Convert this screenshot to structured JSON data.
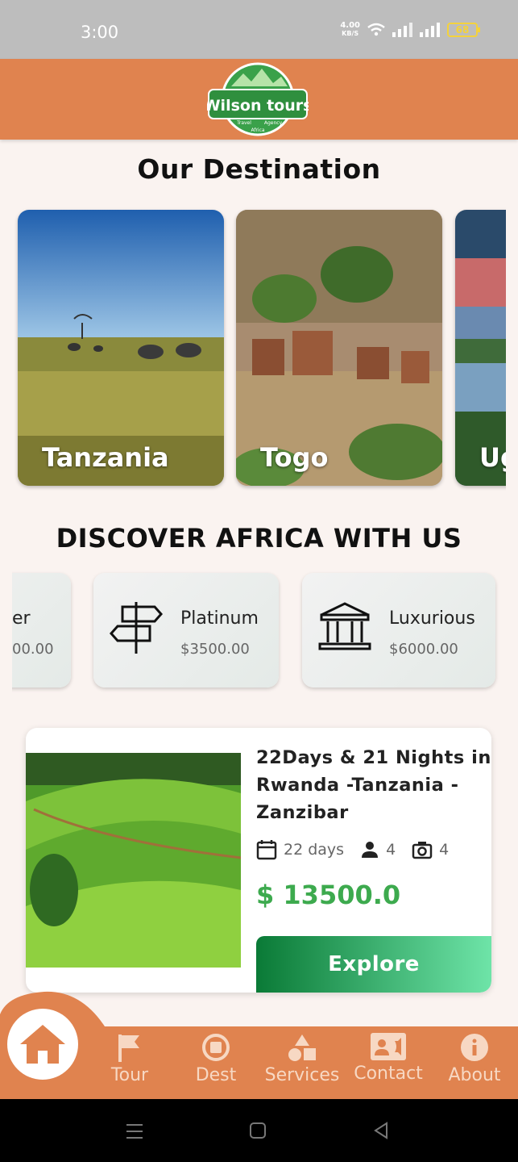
{
  "status_bar": {
    "time": "3:00",
    "net_speed_value": "4.00",
    "net_speed_unit": "KB/S",
    "battery": "68"
  },
  "header": {
    "logo_text": "Wilson tours",
    "logo_sub1": "Travel",
    "logo_sub2": "Agency",
    "logo_sub3": "Africa"
  },
  "destinations": {
    "title": "Our Destination",
    "items": [
      {
        "label": "Tanzania"
      },
      {
        "label": "Togo"
      },
      {
        "label": "Ug"
      }
    ]
  },
  "discover": {
    "title": "DISCOVER AFRICA WITH US",
    "packages": [
      {
        "name": "er",
        "price": "00.00"
      },
      {
        "name": "Platinum",
        "price": "$3500.00",
        "icon": "signpost-icon"
      },
      {
        "name": "Luxurious",
        "price": "$6000.00",
        "icon": "bank-building-icon"
      }
    ]
  },
  "tour": {
    "title": "22Days & 21 Nights in Rwanda -Tanzania -Zanzibar",
    "duration": "22 days",
    "people": "4",
    "photos": "4",
    "price": "$ 13500.0",
    "cta": "Explore"
  },
  "bottom_nav": {
    "items": [
      {
        "label": "Tour",
        "icon": "flag-icon"
      },
      {
        "label": "Dest",
        "icon": "stop-circle-icon"
      },
      {
        "label": "Services",
        "icon": "shapes-icon"
      },
      {
        "label": "Contact",
        "icon": "contact-card-icon"
      },
      {
        "label": "About",
        "icon": "info-icon"
      }
    ]
  }
}
